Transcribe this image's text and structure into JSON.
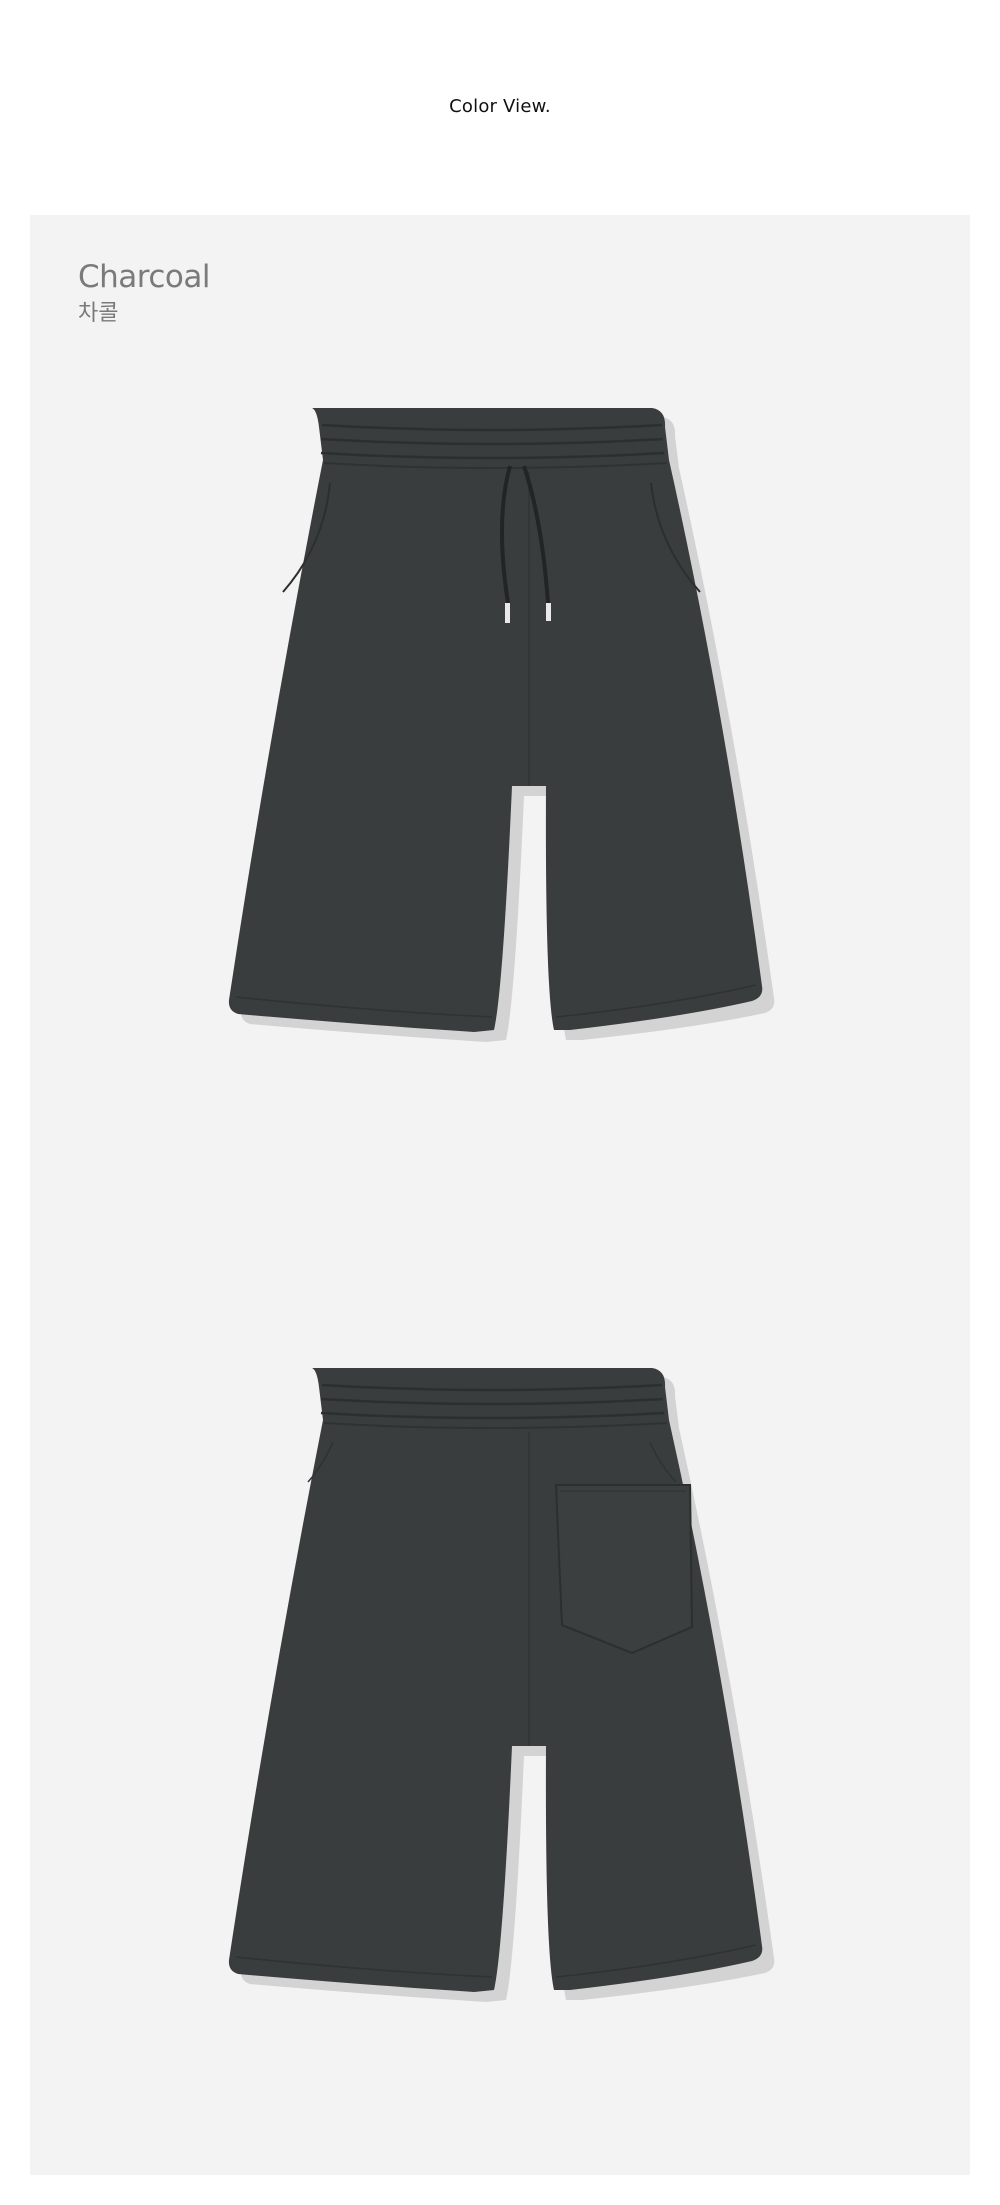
{
  "header": {
    "title": "Color View."
  },
  "colors": [
    {
      "name_en": "Charcoal",
      "name_kr": "차콜",
      "swatch": "#3a3d3d",
      "views": [
        "front",
        "back"
      ]
    }
  ],
  "palette": {
    "panel_bg": "#f3f3f3",
    "fabric": "#3a3d3d",
    "fabric_shade": "#2f3232",
    "shadow": "#d2d2d2",
    "label_text": "#7a7a7a"
  }
}
